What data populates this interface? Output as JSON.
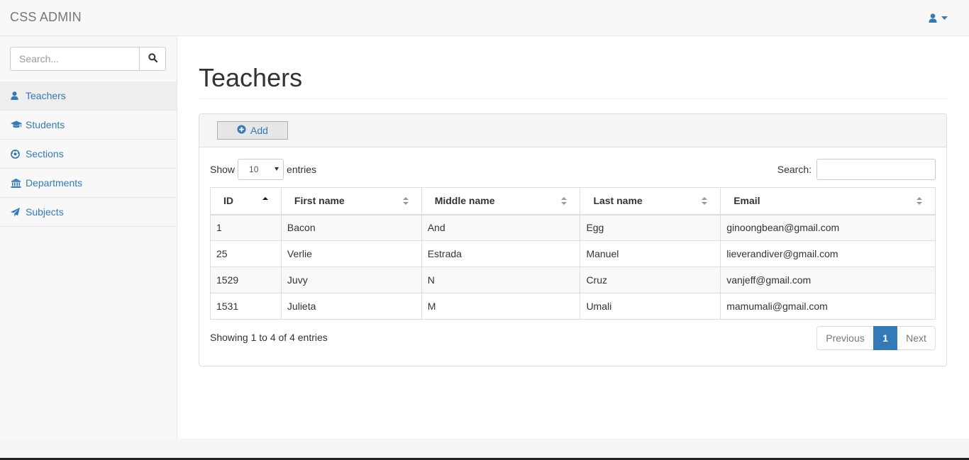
{
  "app": {
    "brand": "CSS ADMIN"
  },
  "navbar": {
    "user_icon": "user-icon",
    "caret_icon": "caret-down-icon"
  },
  "sidebar": {
    "search_placeholder": "Search...",
    "items": [
      {
        "label": "Teachers",
        "icon": "user-icon",
        "active": true
      },
      {
        "label": "Students",
        "icon": "graduation-cap-icon",
        "active": false
      },
      {
        "label": "Sections",
        "icon": "soccer-ball-icon",
        "active": false
      },
      {
        "label": "Departments",
        "icon": "bank-icon",
        "active": false
      },
      {
        "label": "Subjects",
        "icon": "paper-plane-icon",
        "active": false
      }
    ]
  },
  "main": {
    "title": "Teachers",
    "add_label": "Add",
    "length": {
      "show": "Show",
      "value": "10",
      "entries": "entries"
    },
    "search_label": "Search:",
    "table": {
      "columns": [
        "ID",
        "First name",
        "Middle name",
        "Last name",
        "Email"
      ],
      "rows": [
        [
          "1",
          "Bacon",
          "And",
          "Egg",
          "ginoongbean@gmail.com"
        ],
        [
          "25",
          "Verlie",
          "Estrada",
          "Manuel",
          "lieverandiver@gmail.com"
        ],
        [
          "1529",
          "Juvy",
          "N",
          "Cruz",
          "vanjeff@gmail.com"
        ],
        [
          "1531",
          "Julieta",
          "M",
          "Umali",
          "mamumali@gmail.com"
        ]
      ]
    },
    "info": "Showing 1 to 4 of 4 entries",
    "pagination": {
      "previous": "Previous",
      "current": "1",
      "next": "Next"
    }
  },
  "colors": {
    "link": "#337ab7",
    "brand": "#777777",
    "active_page": "#337ab7"
  }
}
